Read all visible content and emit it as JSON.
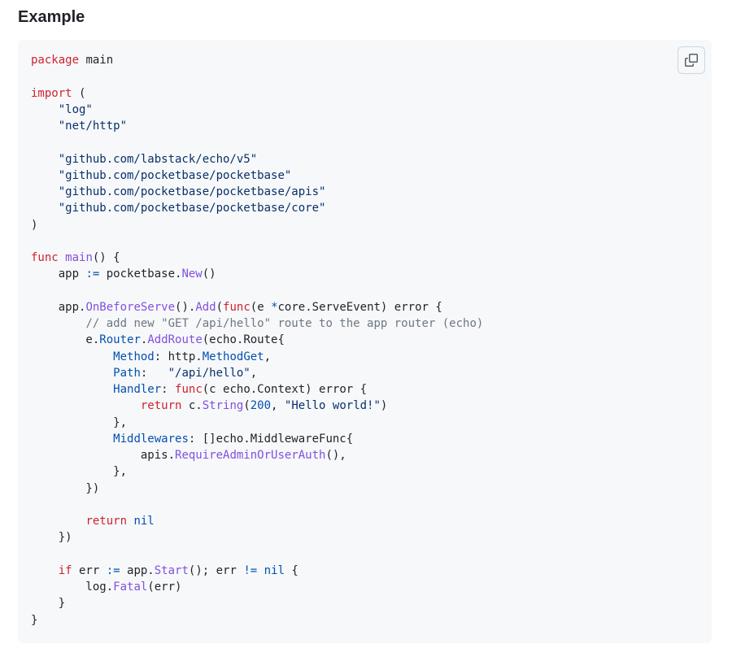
{
  "heading": "Example",
  "code_block": {
    "language": "go",
    "copy_icon": "copy-icon",
    "lines": [
      [
        {
          "t": "kw",
          "v": "package"
        },
        {
          "t": "plain",
          "v": " main"
        }
      ],
      [],
      [
        {
          "t": "kw",
          "v": "import"
        },
        {
          "t": "plain",
          "v": " ("
        }
      ],
      [
        {
          "t": "plain",
          "v": "    "
        },
        {
          "t": "str",
          "v": "\"log\""
        }
      ],
      [
        {
          "t": "plain",
          "v": "    "
        },
        {
          "t": "str",
          "v": "\"net/http\""
        }
      ],
      [],
      [
        {
          "t": "plain",
          "v": "    "
        },
        {
          "t": "str",
          "v": "\"github.com/labstack/echo/v5\""
        }
      ],
      [
        {
          "t": "plain",
          "v": "    "
        },
        {
          "t": "str",
          "v": "\"github.com/pocketbase/pocketbase\""
        }
      ],
      [
        {
          "t": "plain",
          "v": "    "
        },
        {
          "t": "str",
          "v": "\"github.com/pocketbase/pocketbase/apis\""
        }
      ],
      [
        {
          "t": "plain",
          "v": "    "
        },
        {
          "t": "str",
          "v": "\"github.com/pocketbase/pocketbase/core\""
        }
      ],
      [
        {
          "t": "plain",
          "v": ")"
        }
      ],
      [],
      [
        {
          "t": "kw",
          "v": "func"
        },
        {
          "t": "plain",
          "v": " "
        },
        {
          "t": "fn",
          "v": "main"
        },
        {
          "t": "plain",
          "v": "() {"
        }
      ],
      [
        {
          "t": "plain",
          "v": "    app "
        },
        {
          "t": "op",
          "v": ":="
        },
        {
          "t": "plain",
          "v": " pocketbase."
        },
        {
          "t": "fn",
          "v": "New"
        },
        {
          "t": "plain",
          "v": "()"
        }
      ],
      [],
      [
        {
          "t": "plain",
          "v": "    app."
        },
        {
          "t": "fn",
          "v": "OnBeforeServe"
        },
        {
          "t": "plain",
          "v": "()."
        },
        {
          "t": "fn",
          "v": "Add"
        },
        {
          "t": "plain",
          "v": "("
        },
        {
          "t": "kw",
          "v": "func"
        },
        {
          "t": "plain",
          "v": "(e "
        },
        {
          "t": "op",
          "v": "*"
        },
        {
          "t": "plain",
          "v": "core.ServeEvent) error {"
        }
      ],
      [
        {
          "t": "plain",
          "v": "        "
        },
        {
          "t": "cm",
          "v": "// add new \"GET /api/hello\" route to the app router (echo)"
        }
      ],
      [
        {
          "t": "plain",
          "v": "        e."
        },
        {
          "t": "field",
          "v": "Router"
        },
        {
          "t": "plain",
          "v": "."
        },
        {
          "t": "fn",
          "v": "AddRoute"
        },
        {
          "t": "plain",
          "v": "(echo.Route{"
        }
      ],
      [
        {
          "t": "plain",
          "v": "            "
        },
        {
          "t": "field",
          "v": "Method"
        },
        {
          "t": "plain",
          "v": ": http."
        },
        {
          "t": "field",
          "v": "MethodGet"
        },
        {
          "t": "plain",
          "v": ","
        }
      ],
      [
        {
          "t": "plain",
          "v": "            "
        },
        {
          "t": "field",
          "v": "Path"
        },
        {
          "t": "plain",
          "v": ":   "
        },
        {
          "t": "str",
          "v": "\"/api/hello\""
        },
        {
          "t": "plain",
          "v": ","
        }
      ],
      [
        {
          "t": "plain",
          "v": "            "
        },
        {
          "t": "field",
          "v": "Handler"
        },
        {
          "t": "plain",
          "v": ": "
        },
        {
          "t": "kw",
          "v": "func"
        },
        {
          "t": "plain",
          "v": "(c echo.Context) error {"
        }
      ],
      [
        {
          "t": "plain",
          "v": "                "
        },
        {
          "t": "kw",
          "v": "return"
        },
        {
          "t": "plain",
          "v": " c."
        },
        {
          "t": "fn",
          "v": "String"
        },
        {
          "t": "plain",
          "v": "("
        },
        {
          "t": "const",
          "v": "200"
        },
        {
          "t": "plain",
          "v": ", "
        },
        {
          "t": "str",
          "v": "\"Hello world!\""
        },
        {
          "t": "plain",
          "v": ")"
        }
      ],
      [
        {
          "t": "plain",
          "v": "            },"
        }
      ],
      [
        {
          "t": "plain",
          "v": "            "
        },
        {
          "t": "field",
          "v": "Middlewares"
        },
        {
          "t": "plain",
          "v": ": []echo.MiddlewareFunc{"
        }
      ],
      [
        {
          "t": "plain",
          "v": "                apis."
        },
        {
          "t": "fn",
          "v": "RequireAdminOrUserAuth"
        },
        {
          "t": "plain",
          "v": "(),"
        }
      ],
      [
        {
          "t": "plain",
          "v": "            },"
        }
      ],
      [
        {
          "t": "plain",
          "v": "        })"
        }
      ],
      [],
      [
        {
          "t": "plain",
          "v": "        "
        },
        {
          "t": "kw",
          "v": "return"
        },
        {
          "t": "plain",
          "v": " "
        },
        {
          "t": "const",
          "v": "nil"
        }
      ],
      [
        {
          "t": "plain",
          "v": "    })"
        }
      ],
      [],
      [
        {
          "t": "plain",
          "v": "    "
        },
        {
          "t": "kw",
          "v": "if"
        },
        {
          "t": "plain",
          "v": " err "
        },
        {
          "t": "op",
          "v": ":="
        },
        {
          "t": "plain",
          "v": " app."
        },
        {
          "t": "fn",
          "v": "Start"
        },
        {
          "t": "plain",
          "v": "(); err "
        },
        {
          "t": "op",
          "v": "!="
        },
        {
          "t": "plain",
          "v": " "
        },
        {
          "t": "const",
          "v": "nil"
        },
        {
          "t": "plain",
          "v": " {"
        }
      ],
      [
        {
          "t": "plain",
          "v": "        log."
        },
        {
          "t": "fn",
          "v": "Fatal"
        },
        {
          "t": "plain",
          "v": "(err)"
        }
      ],
      [
        {
          "t": "plain",
          "v": "    }"
        }
      ],
      [
        {
          "t": "plain",
          "v": "}"
        }
      ]
    ]
  }
}
